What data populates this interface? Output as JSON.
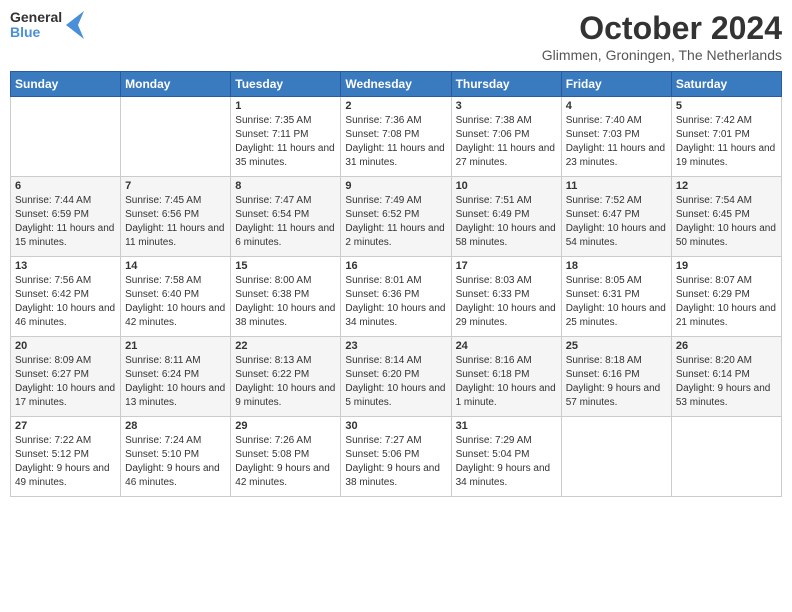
{
  "header": {
    "logo_line1": "General",
    "logo_line2": "Blue",
    "month_title": "October 2024",
    "location": "Glimmen, Groningen, The Netherlands"
  },
  "weekdays": [
    "Sunday",
    "Monday",
    "Tuesday",
    "Wednesday",
    "Thursday",
    "Friday",
    "Saturday"
  ],
  "weeks": [
    [
      {
        "day": "",
        "info": ""
      },
      {
        "day": "",
        "info": ""
      },
      {
        "day": "1",
        "info": "Sunrise: 7:35 AM\nSunset: 7:11 PM\nDaylight: 11 hours and 35 minutes."
      },
      {
        "day": "2",
        "info": "Sunrise: 7:36 AM\nSunset: 7:08 PM\nDaylight: 11 hours and 31 minutes."
      },
      {
        "day": "3",
        "info": "Sunrise: 7:38 AM\nSunset: 7:06 PM\nDaylight: 11 hours and 27 minutes."
      },
      {
        "day": "4",
        "info": "Sunrise: 7:40 AM\nSunset: 7:03 PM\nDaylight: 11 hours and 23 minutes."
      },
      {
        "day": "5",
        "info": "Sunrise: 7:42 AM\nSunset: 7:01 PM\nDaylight: 11 hours and 19 minutes."
      }
    ],
    [
      {
        "day": "6",
        "info": "Sunrise: 7:44 AM\nSunset: 6:59 PM\nDaylight: 11 hours and 15 minutes."
      },
      {
        "day": "7",
        "info": "Sunrise: 7:45 AM\nSunset: 6:56 PM\nDaylight: 11 hours and 11 minutes."
      },
      {
        "day": "8",
        "info": "Sunrise: 7:47 AM\nSunset: 6:54 PM\nDaylight: 11 hours and 6 minutes."
      },
      {
        "day": "9",
        "info": "Sunrise: 7:49 AM\nSunset: 6:52 PM\nDaylight: 11 hours and 2 minutes."
      },
      {
        "day": "10",
        "info": "Sunrise: 7:51 AM\nSunset: 6:49 PM\nDaylight: 10 hours and 58 minutes."
      },
      {
        "day": "11",
        "info": "Sunrise: 7:52 AM\nSunset: 6:47 PM\nDaylight: 10 hours and 54 minutes."
      },
      {
        "day": "12",
        "info": "Sunrise: 7:54 AM\nSunset: 6:45 PM\nDaylight: 10 hours and 50 minutes."
      }
    ],
    [
      {
        "day": "13",
        "info": "Sunrise: 7:56 AM\nSunset: 6:42 PM\nDaylight: 10 hours and 46 minutes."
      },
      {
        "day": "14",
        "info": "Sunrise: 7:58 AM\nSunset: 6:40 PM\nDaylight: 10 hours and 42 minutes."
      },
      {
        "day": "15",
        "info": "Sunrise: 8:00 AM\nSunset: 6:38 PM\nDaylight: 10 hours and 38 minutes."
      },
      {
        "day": "16",
        "info": "Sunrise: 8:01 AM\nSunset: 6:36 PM\nDaylight: 10 hours and 34 minutes."
      },
      {
        "day": "17",
        "info": "Sunrise: 8:03 AM\nSunset: 6:33 PM\nDaylight: 10 hours and 29 minutes."
      },
      {
        "day": "18",
        "info": "Sunrise: 8:05 AM\nSunset: 6:31 PM\nDaylight: 10 hours and 25 minutes."
      },
      {
        "day": "19",
        "info": "Sunrise: 8:07 AM\nSunset: 6:29 PM\nDaylight: 10 hours and 21 minutes."
      }
    ],
    [
      {
        "day": "20",
        "info": "Sunrise: 8:09 AM\nSunset: 6:27 PM\nDaylight: 10 hours and 17 minutes."
      },
      {
        "day": "21",
        "info": "Sunrise: 8:11 AM\nSunset: 6:24 PM\nDaylight: 10 hours and 13 minutes."
      },
      {
        "day": "22",
        "info": "Sunrise: 8:13 AM\nSunset: 6:22 PM\nDaylight: 10 hours and 9 minutes."
      },
      {
        "day": "23",
        "info": "Sunrise: 8:14 AM\nSunset: 6:20 PM\nDaylight: 10 hours and 5 minutes."
      },
      {
        "day": "24",
        "info": "Sunrise: 8:16 AM\nSunset: 6:18 PM\nDaylight: 10 hours and 1 minute."
      },
      {
        "day": "25",
        "info": "Sunrise: 8:18 AM\nSunset: 6:16 PM\nDaylight: 9 hours and 57 minutes."
      },
      {
        "day": "26",
        "info": "Sunrise: 8:20 AM\nSunset: 6:14 PM\nDaylight: 9 hours and 53 minutes."
      }
    ],
    [
      {
        "day": "27",
        "info": "Sunrise: 7:22 AM\nSunset: 5:12 PM\nDaylight: 9 hours and 49 minutes."
      },
      {
        "day": "28",
        "info": "Sunrise: 7:24 AM\nSunset: 5:10 PM\nDaylight: 9 hours and 46 minutes."
      },
      {
        "day": "29",
        "info": "Sunrise: 7:26 AM\nSunset: 5:08 PM\nDaylight: 9 hours and 42 minutes."
      },
      {
        "day": "30",
        "info": "Sunrise: 7:27 AM\nSunset: 5:06 PM\nDaylight: 9 hours and 38 minutes."
      },
      {
        "day": "31",
        "info": "Sunrise: 7:29 AM\nSunset: 5:04 PM\nDaylight: 9 hours and 34 minutes."
      },
      {
        "day": "",
        "info": ""
      },
      {
        "day": "",
        "info": ""
      }
    ]
  ]
}
